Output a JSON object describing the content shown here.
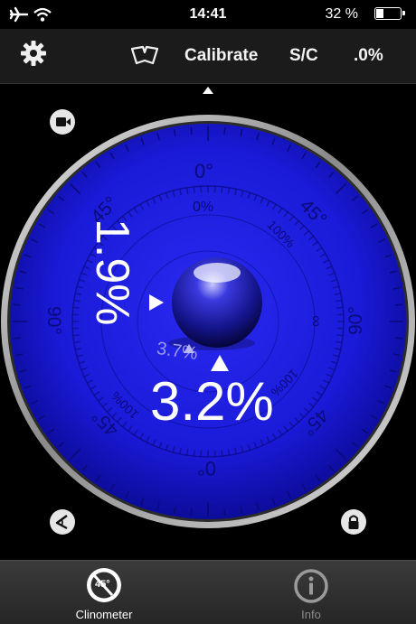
{
  "status_bar": {
    "time": "14:41",
    "battery_text": "32 %",
    "battery_level": 0.32
  },
  "toolbar": {
    "calibrate_label": "Calibrate",
    "sc_label": "S/C",
    "precision_label": ".0%"
  },
  "dial": {
    "top_degree": "0°",
    "bottom_degree": "0°",
    "left_degree": "90°",
    "right_degree": "90°",
    "diag_tl": "45°",
    "diag_tr": "45°",
    "diag_bl": "45°",
    "diag_br": "45°",
    "inner_top_percent": "0%",
    "inner_tr_percent": "100%",
    "inner_bl_percent": "100%",
    "inner_br_percent": "100%",
    "inner_right": "∞"
  },
  "readings": {
    "vertical": "1.9%",
    "horizontal": "3.2%",
    "combined": "3.7%"
  },
  "tabs": [
    {
      "label": "Clinometer",
      "badge": "45°",
      "active": true
    },
    {
      "label": "Info",
      "active": false
    }
  ],
  "colors": {
    "dial_blue": "#1a1ae0",
    "tab_active": "#ffffff",
    "tab_inactive": "#8a8a8a"
  }
}
